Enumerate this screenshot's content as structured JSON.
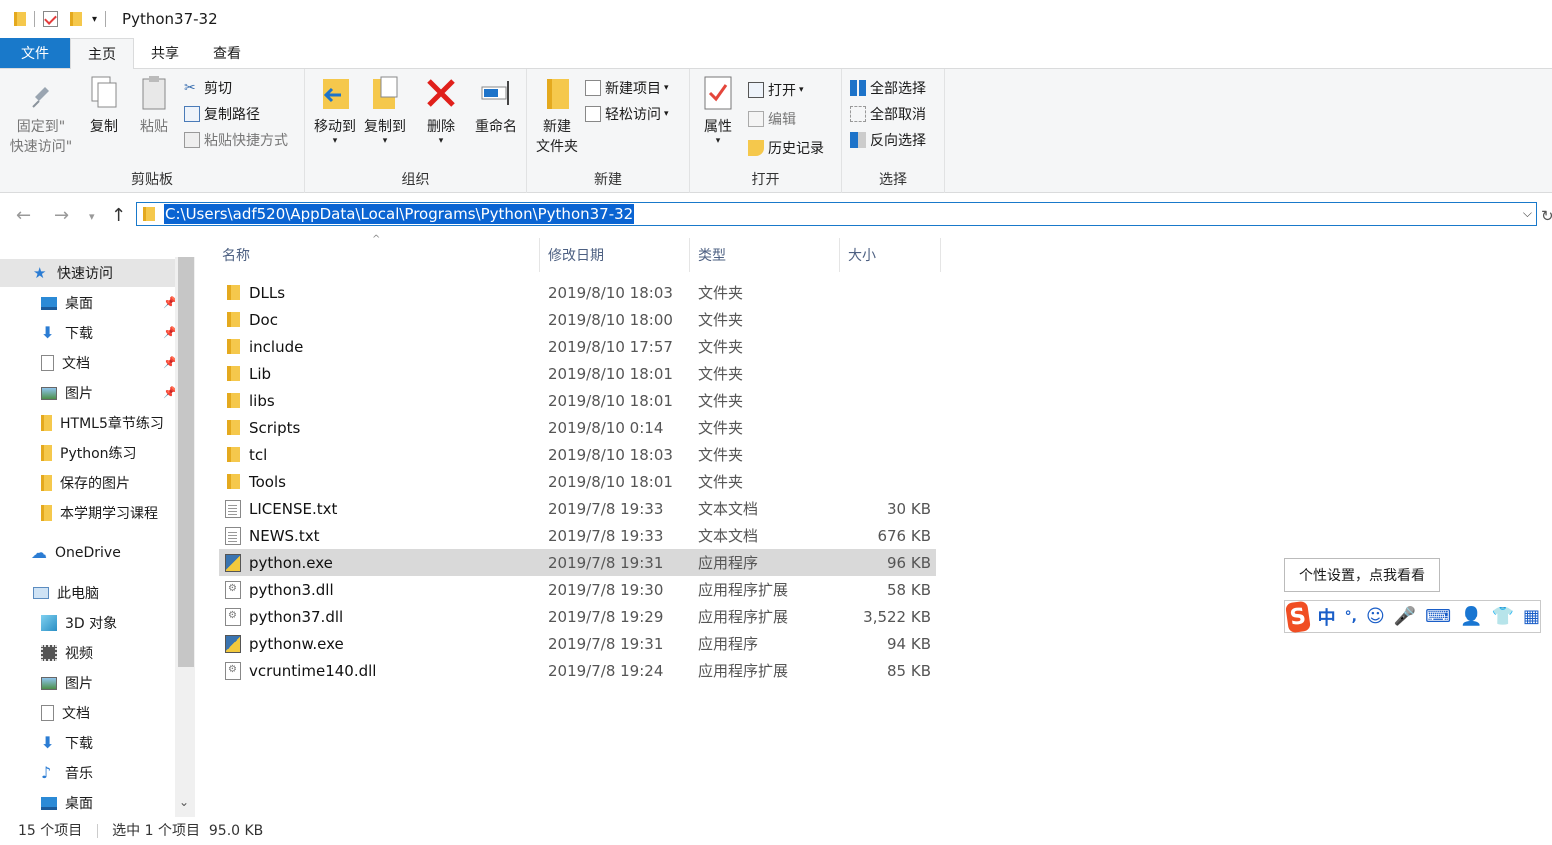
{
  "window": {
    "title": "Python37-32"
  },
  "tabs": {
    "file": "文件",
    "home": "主页",
    "share": "共享",
    "view": "查看"
  },
  "ribbon": {
    "clipboard": {
      "label": "剪贴板",
      "pin_line1": "固定到\"",
      "pin_line2": "快速访问\"",
      "copy": "复制",
      "paste": "粘贴",
      "cut": "剪切",
      "copy_path": "复制路径",
      "paste_shortcut": "粘贴快捷方式"
    },
    "organize": {
      "label": "组织",
      "move_to": "移动到",
      "copy_to": "复制到",
      "delete": "删除",
      "rename": "重命名"
    },
    "new": {
      "label": "新建",
      "new_folder_line1": "新建",
      "new_folder_line2": "文件夹",
      "new_item": "新建项目",
      "easy_access": "轻松访问"
    },
    "open": {
      "label": "打开",
      "properties": "属性",
      "open": "打开",
      "edit": "编辑",
      "history": "历史记录"
    },
    "select": {
      "label": "选择",
      "select_all": "全部选择",
      "select_none": "全部取消",
      "invert": "反向选择"
    }
  },
  "address": {
    "path": "C:\\Users\\adf520\\AppData\\Local\\Programs\\Python\\Python37-32"
  },
  "navpane": {
    "quick_access": "快速访问",
    "qa_items": [
      "桌面",
      "下载",
      "文档",
      "图片",
      "HTML5章节练习",
      "Python练习",
      "保存的图片",
      "本学期学习课程"
    ],
    "onedrive": "OneDrive",
    "this_pc": "此电脑",
    "pc_items": [
      "3D 对象",
      "视频",
      "图片",
      "文档",
      "下载",
      "音乐",
      "桌面"
    ]
  },
  "columns": {
    "name": "名称",
    "date": "修改日期",
    "type": "类型",
    "size": "大小"
  },
  "files": [
    {
      "name": "DLLs",
      "date": "2019/8/10 18:03",
      "type": "文件夹",
      "size": "",
      "icon": "folder"
    },
    {
      "name": "Doc",
      "date": "2019/8/10 18:00",
      "type": "文件夹",
      "size": "",
      "icon": "folder"
    },
    {
      "name": "include",
      "date": "2019/8/10 17:57",
      "type": "文件夹",
      "size": "",
      "icon": "folder"
    },
    {
      "name": "Lib",
      "date": "2019/8/10 18:01",
      "type": "文件夹",
      "size": "",
      "icon": "folder"
    },
    {
      "name": "libs",
      "date": "2019/8/10 18:01",
      "type": "文件夹",
      "size": "",
      "icon": "folder"
    },
    {
      "name": "Scripts",
      "date": "2019/8/10 0:14",
      "type": "文件夹",
      "size": "",
      "icon": "folder"
    },
    {
      "name": "tcl",
      "date": "2019/8/10 18:03",
      "type": "文件夹",
      "size": "",
      "icon": "folder"
    },
    {
      "name": "Tools",
      "date": "2019/8/10 18:01",
      "type": "文件夹",
      "size": "",
      "icon": "folder"
    },
    {
      "name": "LICENSE.txt",
      "date": "2019/7/8 19:33",
      "type": "文本文档",
      "size": "30 KB",
      "icon": "doc"
    },
    {
      "name": "NEWS.txt",
      "date": "2019/7/8 19:33",
      "type": "文本文档",
      "size": "676 KB",
      "icon": "doc"
    },
    {
      "name": "python.exe",
      "date": "2019/7/8 19:31",
      "type": "应用程序",
      "size": "96 KB",
      "icon": "exe",
      "selected": true
    },
    {
      "name": "python3.dll",
      "date": "2019/7/8 19:30",
      "type": "应用程序扩展",
      "size": "58 KB",
      "icon": "dll"
    },
    {
      "name": "python37.dll",
      "date": "2019/7/8 19:29",
      "type": "应用程序扩展",
      "size": "3,522 KB",
      "icon": "dll"
    },
    {
      "name": "pythonw.exe",
      "date": "2019/7/8 19:31",
      "type": "应用程序",
      "size": "94 KB",
      "icon": "exe"
    },
    {
      "name": "vcruntime140.dll",
      "date": "2019/7/8 19:24",
      "type": "应用程序扩展",
      "size": "85 KB",
      "icon": "dll"
    }
  ],
  "status": {
    "count": "15 个项目",
    "selection": "选中 1 个项目  95.0 KB"
  },
  "ime": {
    "tooltip": "个性设置，点我看看",
    "logo": "S",
    "mode": "中",
    "punct": "°,"
  }
}
